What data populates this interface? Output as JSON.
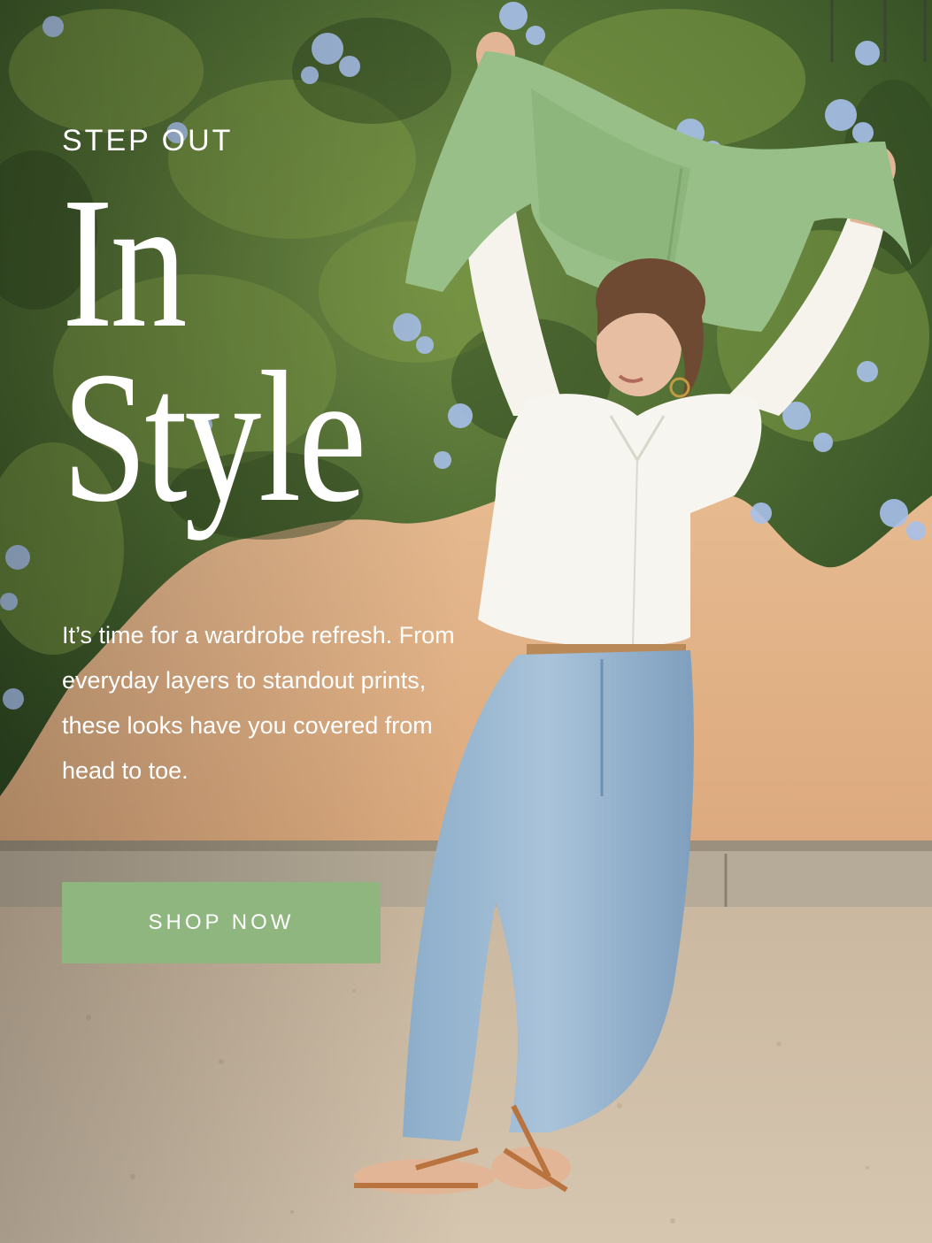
{
  "hero": {
    "eyebrow": "STEP OUT",
    "headline_line1": "In",
    "headline_line2": "Style",
    "body": "It’s time for a wardrobe refresh. From everyday layers to standout prints, these looks have you covered from head to toe.",
    "cta_label": "SHOP NOW"
  },
  "colors": {
    "cta_background": "#8fb67f",
    "text": "#ffffff",
    "cardigan": "#97bf86",
    "shirt": "#f7f5ef",
    "jeans": "#8fb1cf",
    "wall": "#e7b98e",
    "foliage": "#4e6d34",
    "flowers": "#a7bfe8",
    "gravel": "#ccb9a0"
  },
  "image": {
    "description": "Woman in white shirt and light wash barrel jeans holding a green cardigan overhead in front of a flowering hedge"
  }
}
